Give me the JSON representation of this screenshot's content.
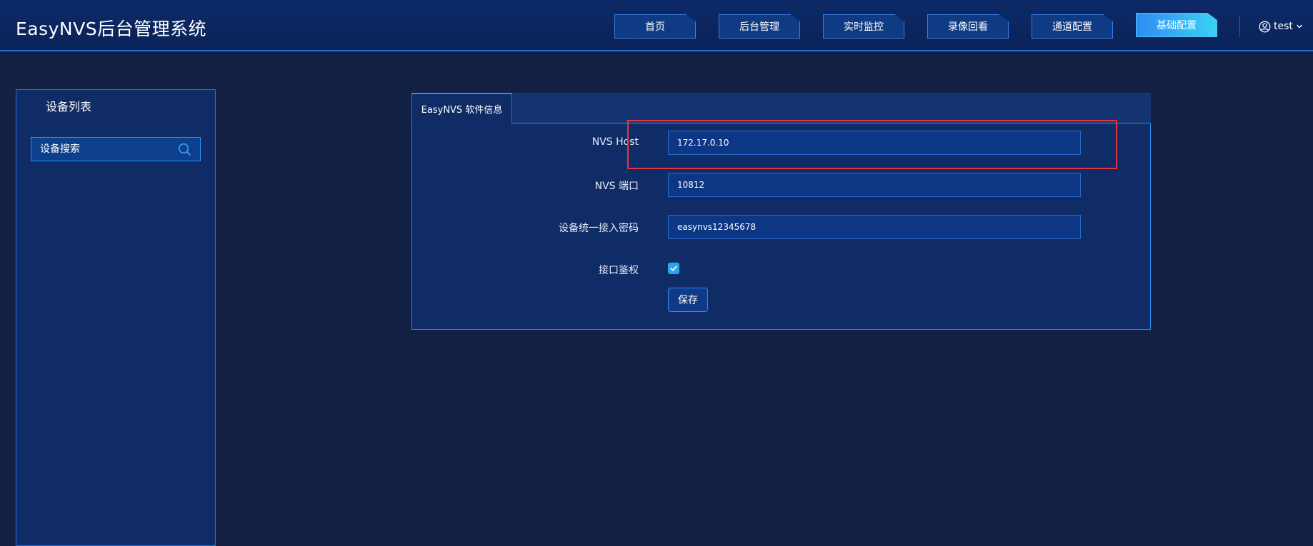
{
  "header": {
    "title": "EasyNVS后台管理系统",
    "nav": [
      {
        "label": "首页",
        "active": false
      },
      {
        "label": "后台管理",
        "active": false
      },
      {
        "label": "实时监控",
        "active": false
      },
      {
        "label": "录像回看",
        "active": false
      },
      {
        "label": "通道配置",
        "active": false
      },
      {
        "label": "基础配置",
        "active": true
      }
    ],
    "user": {
      "name": "test",
      "icon": "user-circle-icon",
      "dropdown_icon": "chevron-down-icon"
    }
  },
  "sidebar": {
    "title": "设备列表",
    "search": {
      "placeholder": "设备搜索",
      "icon": "search-icon"
    }
  },
  "main": {
    "tab": {
      "label": "EasyNVS 软件信息"
    },
    "form": {
      "host": {
        "label": "NVS Host",
        "value": "172.17.0.10"
      },
      "port": {
        "label": "NVS 端口",
        "value": "10812"
      },
      "password": {
        "label": "设备统一接入密码",
        "value": "easynvs12345678"
      },
      "auth": {
        "label": "接口鉴权",
        "checked": true
      },
      "save_label": "保存"
    }
  },
  "colors": {
    "background": "#122043",
    "header": "#0a2258",
    "panel": "#0f2c66",
    "accent": "#2f8cf0",
    "active_tab": "#3ad1f5",
    "highlight": "#e5343e"
  }
}
